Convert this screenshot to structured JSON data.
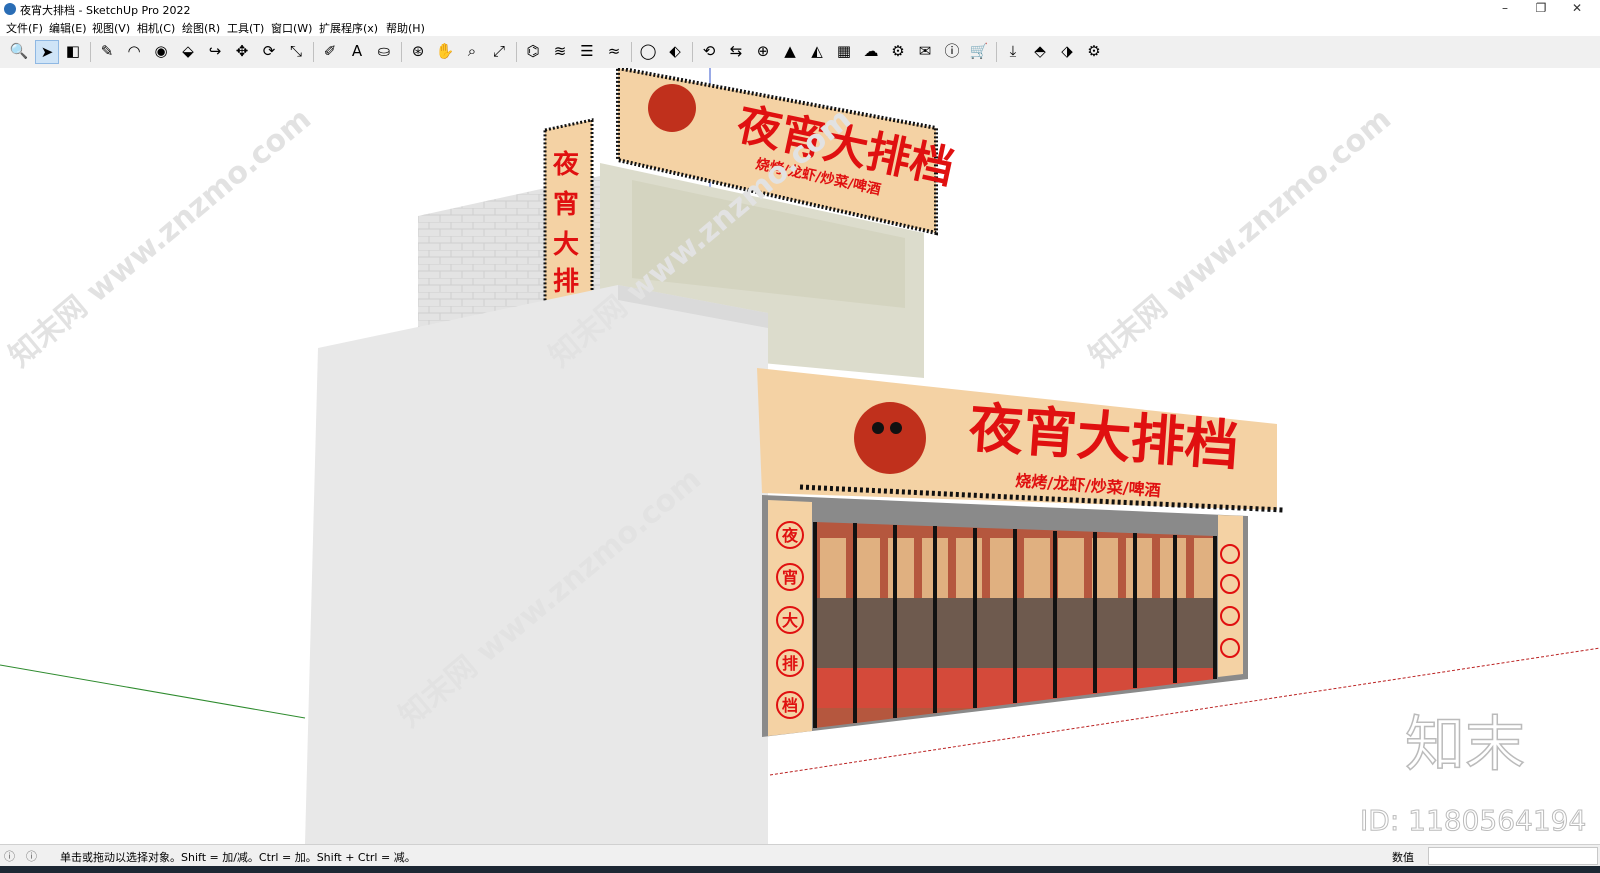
{
  "window": {
    "title": "夜宵大排档 - SketchUp Pro 2022",
    "controls": {
      "minimize": "–",
      "restore": "❐",
      "close": "✕"
    }
  },
  "menu": [
    "文件(F)",
    "编辑(E)",
    "视图(V)",
    "相机(C)",
    "绘图(R)",
    "工具(T)",
    "窗口(W)",
    "扩展程序(x)",
    "帮助(H)"
  ],
  "toolbar": {
    "icons": [
      {
        "name": "zoom-icon",
        "glyph": "🔍"
      },
      {
        "name": "select-icon",
        "glyph": "➤",
        "selected": true
      },
      {
        "name": "eraser-icon",
        "glyph": "◧"
      },
      {
        "name": "pencil-icon",
        "glyph": "✎"
      },
      {
        "name": "arc-icon",
        "glyph": "◠"
      },
      {
        "name": "shapes-icon",
        "glyph": "◉"
      },
      {
        "name": "push-pull-icon",
        "glyph": "⬙"
      },
      {
        "name": "follow-me-icon",
        "glyph": "↪"
      },
      {
        "name": "move-icon",
        "glyph": "✥"
      },
      {
        "name": "rotate-icon",
        "glyph": "⟳"
      },
      {
        "name": "scale-icon",
        "glyph": "⤡"
      },
      {
        "name": "tape-measure-icon",
        "glyph": "✐"
      },
      {
        "name": "text-icon",
        "glyph": "A"
      },
      {
        "name": "paint-bucket-icon",
        "glyph": "⛀"
      },
      {
        "name": "orbit-icon",
        "glyph": "⊛"
      },
      {
        "name": "pan-icon",
        "glyph": "✋"
      },
      {
        "name": "zoom-window-icon",
        "glyph": "⌕"
      },
      {
        "name": "zoom-extents-icon",
        "glyph": "⤢"
      },
      {
        "name": "warehouse-icon",
        "glyph": "⌬"
      },
      {
        "name": "extension-warehouse-icon",
        "glyph": "≋"
      },
      {
        "name": "layout-icon",
        "glyph": "☰"
      },
      {
        "name": "sandbox-icon",
        "glyph": "≈"
      },
      {
        "name": "user-icon",
        "glyph": "◯"
      },
      {
        "name": "ext-1-icon",
        "glyph": "⬖"
      },
      {
        "name": "refresh-icon",
        "glyph": "⟲"
      },
      {
        "name": "ext-2-icon",
        "glyph": "⇆"
      },
      {
        "name": "add-icon",
        "glyph": "⊕"
      },
      {
        "name": "tree-icon",
        "glyph": "▲"
      },
      {
        "name": "ext-3-icon",
        "glyph": "◭"
      },
      {
        "name": "checker-icon",
        "glyph": "▦"
      },
      {
        "name": "cloud-icon",
        "glyph": "☁"
      },
      {
        "name": "gear-icon",
        "glyph": "⚙"
      },
      {
        "name": "mail-icon",
        "glyph": "✉"
      },
      {
        "name": "info-icon",
        "glyph": "ⓘ"
      },
      {
        "name": "cart-icon",
        "glyph": "🛒"
      },
      {
        "name": "download-icon",
        "glyph": "⤓"
      },
      {
        "name": "ext-4-icon",
        "glyph": "⬘"
      },
      {
        "name": "ext-5-icon",
        "glyph": "⬗"
      },
      {
        "name": "settings-icon",
        "glyph": "⚙"
      }
    ]
  },
  "scene": {
    "sign_main": "夜宵大排档",
    "sign_sub": "烧烤/龙虾/炒菜/啤酒",
    "couplet_left": [
      "夜",
      "宵",
      "大",
      "排",
      "档"
    ],
    "watermark": "知末网 www.znzmo.com",
    "brand_mark": "知末",
    "id_label": "ID: 1180564194"
  },
  "status": {
    "hint": "单击或拖动以选择对象。Shift = 加/减。Ctrl = 加。Shift + Ctrl = 减。",
    "measure_label": "数值",
    "measure_value": ""
  }
}
